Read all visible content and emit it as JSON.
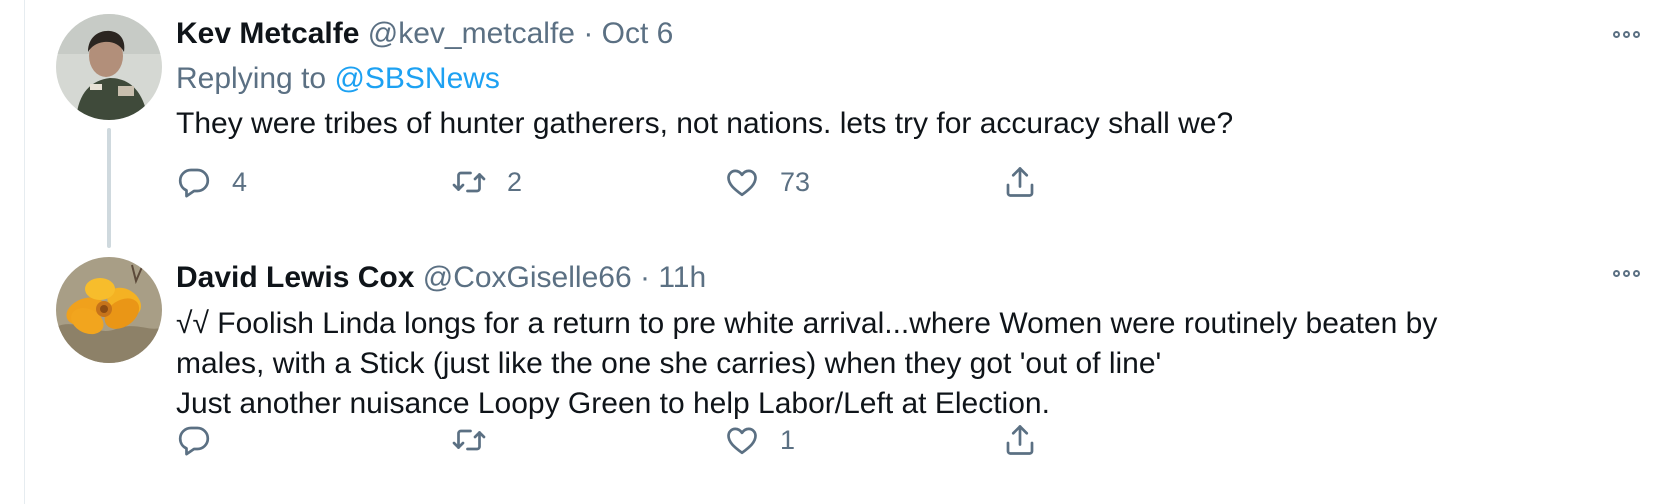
{
  "tweets": [
    {
      "name": "Kev Metcalfe",
      "handle": "@kev_metcalfe",
      "separator": "·",
      "time": "Oct 6",
      "replying_prefix": "Replying to",
      "replying_to": "@SBSNews",
      "text_lines": [
        "They were tribes of hunter gatherers, not nations. lets try for accuracy shall we?"
      ],
      "counts": {
        "reply": "4",
        "retweet": "2",
        "like": "73"
      }
    },
    {
      "name": "David Lewis Cox",
      "handle": "@CoxGiselle66",
      "separator": "·",
      "time": "11h",
      "text_lines": [
        "√√ Foolish Linda longs for a return to pre white arrival...where Women were routinely beaten by",
        "males, with a Stick (just like the one she carries) when they got 'out of line'",
        "Just another nuisance Loopy Green to help Labor/Left at Election."
      ],
      "counts": {
        "reply": "",
        "retweet": "",
        "like": "1"
      }
    }
  ],
  "colors": {
    "text": "#0f1419",
    "muted": "#5b7083",
    "link": "#1da1f2",
    "thread_line": "#cfd9de"
  },
  "icons": [
    "reply-icon",
    "retweet-icon",
    "like-icon",
    "share-icon",
    "more-icon"
  ]
}
